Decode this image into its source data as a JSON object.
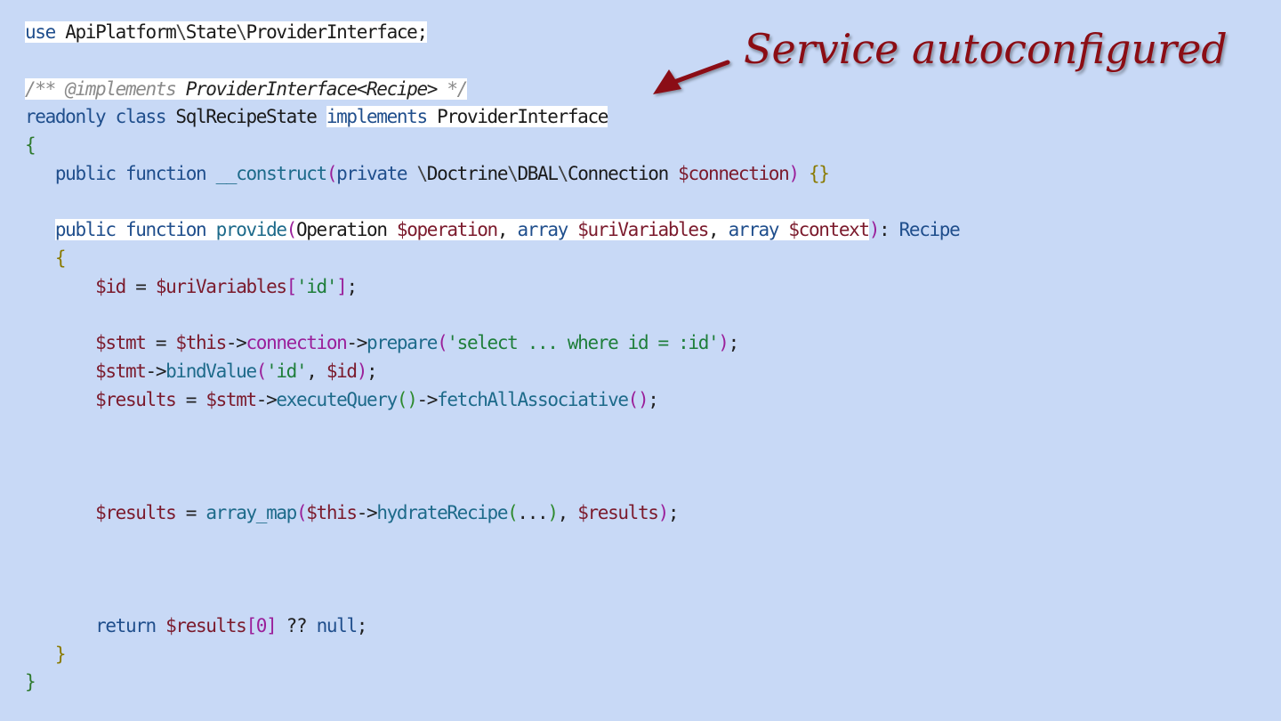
{
  "annotation": {
    "text": "Service autoconfigured",
    "color": "#8b0d14"
  },
  "code": {
    "l1": {
      "use": "use",
      "ns1": "ApiPlatform",
      "ns2": "State",
      "ns3": "ProviderInterface",
      "semi": ";"
    },
    "l3": {
      "comment": "/** @implements ",
      "type": "ProviderInterface<Recipe>",
      "end": " */"
    },
    "l4": {
      "readonly": "readonly",
      "class": "class",
      "name": "SqlRecipeState",
      "implements": "implements",
      "iface": "ProviderInterface"
    },
    "l5": {
      "brace": "{"
    },
    "l6": {
      "public": "public",
      "function": "function",
      "name": "__construct",
      "open": "(",
      "private": "private",
      "ns1": "Doctrine",
      "ns2": "DBAL",
      "ns3": "Connection",
      "var": "$connection",
      "close": ")",
      "body": "{}"
    },
    "l8": {
      "public": "public",
      "function": "function",
      "name": "provide",
      "open": "(",
      "t1": "Operation",
      "v1": "$operation",
      "t2": "array",
      "v2": "$uriVariables",
      "t3": "array",
      "v3": "$context",
      "close": ")",
      "colon": ":",
      "ret": "Recipe"
    },
    "l9": {
      "brace": "{"
    },
    "l10": {
      "v": "$id",
      "eq": " = ",
      "v2": "$uriVariables",
      "o": "[",
      "s": "'id'",
      "c": "]",
      "semi": ";"
    },
    "l12": {
      "v": "$stmt",
      "eq": " = ",
      "t": "$this",
      "a1": "->",
      "p": "connection",
      "a2": "->",
      "f": "prepare",
      "o": "(",
      "s": "'select ... where id = :id'",
      "c": ")",
      "semi": ";"
    },
    "l13": {
      "v": "$stmt",
      "a": "->",
      "f": "bindValue",
      "o": "(",
      "s": "'id'",
      "cm": ", ",
      "v2": "$id",
      "c": ")",
      "semi": ";"
    },
    "l14": {
      "v": "$results",
      "eq": " = ",
      "v2": "$stmt",
      "a1": "->",
      "f1": "executeQuery",
      "p1": "()",
      "a2": "->",
      "f2": "fetchAllAssociative",
      "p2": "()",
      "semi": ";"
    },
    "l18": {
      "v": "$results",
      "eq": " = ",
      "f": "array_map",
      "o": "(",
      "t": "$this",
      "a": "->",
      "f2": "hydrateRecipe",
      "o2": "(",
      "dots": "...",
      "c2": ")",
      "cm": ", ",
      "v2": "$results",
      "c": ")",
      "semi": ";"
    },
    "l22": {
      "ret": "return",
      "v": "$results",
      "o": "[",
      "n": "0",
      "c": "]",
      "op": " ?? ",
      "null": "null",
      "semi": ";"
    },
    "l23": {
      "brace": "}"
    },
    "l24": {
      "brace": "}"
    }
  }
}
